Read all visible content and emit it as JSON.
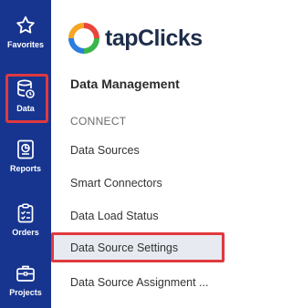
{
  "rail": {
    "items": [
      {
        "label": "Favorites",
        "icon": "star-icon"
      },
      {
        "label": "Data",
        "icon": "database-icon"
      },
      {
        "label": "Reports",
        "icon": "report-icon"
      },
      {
        "label": "Orders",
        "icon": "clipboard-check-icon"
      },
      {
        "label": "Projects",
        "icon": "briefcase-icon"
      }
    ],
    "active_item": "Data"
  },
  "brand": {
    "name": "tapClicks",
    "accent_colors": [
      "#e8453c",
      "#f5a623",
      "#3ab54a",
      "#2b7de0"
    ]
  },
  "panel": {
    "title": "Data Management",
    "section_label": "CONNECT",
    "items": [
      {
        "label": "Data Sources"
      },
      {
        "label": "Smart Connectors"
      },
      {
        "label": "Data Load Status"
      },
      {
        "label": "Data Source Settings"
      },
      {
        "label": "Data Source Assignment ..."
      }
    ],
    "selected_item": "Data Source Settings"
  },
  "colors": {
    "rail_background": "#17358f",
    "highlight_border": "#e0393e",
    "selected_background": "#e7eaf1"
  }
}
